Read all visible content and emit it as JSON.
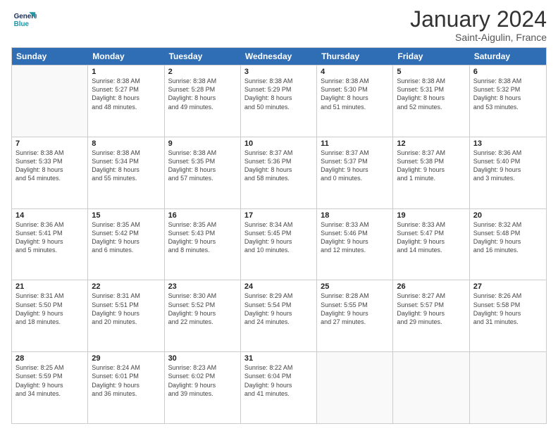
{
  "header": {
    "logo_line1": "General",
    "logo_line2": "Blue",
    "month": "January 2024",
    "location": "Saint-Aigulin, France"
  },
  "days": [
    "Sunday",
    "Monday",
    "Tuesday",
    "Wednesday",
    "Thursday",
    "Friday",
    "Saturday"
  ],
  "rows": [
    [
      {
        "day": "",
        "sunrise": "",
        "sunset": "",
        "daylight": ""
      },
      {
        "day": "1",
        "sunrise": "Sunrise: 8:38 AM",
        "sunset": "Sunset: 5:27 PM",
        "daylight": "Daylight: 8 hours and 48 minutes."
      },
      {
        "day": "2",
        "sunrise": "Sunrise: 8:38 AM",
        "sunset": "Sunset: 5:28 PM",
        "daylight": "Daylight: 8 hours and 49 minutes."
      },
      {
        "day": "3",
        "sunrise": "Sunrise: 8:38 AM",
        "sunset": "Sunset: 5:29 PM",
        "daylight": "Daylight: 8 hours and 50 minutes."
      },
      {
        "day": "4",
        "sunrise": "Sunrise: 8:38 AM",
        "sunset": "Sunset: 5:30 PM",
        "daylight": "Daylight: 8 hours and 51 minutes."
      },
      {
        "day": "5",
        "sunrise": "Sunrise: 8:38 AM",
        "sunset": "Sunset: 5:31 PM",
        "daylight": "Daylight: 8 hours and 52 minutes."
      },
      {
        "day": "6",
        "sunrise": "Sunrise: 8:38 AM",
        "sunset": "Sunset: 5:32 PM",
        "daylight": "Daylight: 8 hours and 53 minutes."
      }
    ],
    [
      {
        "day": "7",
        "sunrise": "Sunrise: 8:38 AM",
        "sunset": "Sunset: 5:33 PM",
        "daylight": "Daylight: 8 hours and 54 minutes."
      },
      {
        "day": "8",
        "sunrise": "Sunrise: 8:38 AM",
        "sunset": "Sunset: 5:34 PM",
        "daylight": "Daylight: 8 hours and 55 minutes."
      },
      {
        "day": "9",
        "sunrise": "Sunrise: 8:38 AM",
        "sunset": "Sunset: 5:35 PM",
        "daylight": "Daylight: 8 hours and 57 minutes."
      },
      {
        "day": "10",
        "sunrise": "Sunrise: 8:37 AM",
        "sunset": "Sunset: 5:36 PM",
        "daylight": "Daylight: 8 hours and 58 minutes."
      },
      {
        "day": "11",
        "sunrise": "Sunrise: 8:37 AM",
        "sunset": "Sunset: 5:37 PM",
        "daylight": "Daylight: 9 hours and 0 minutes."
      },
      {
        "day": "12",
        "sunrise": "Sunrise: 8:37 AM",
        "sunset": "Sunset: 5:38 PM",
        "daylight": "Daylight: 9 hours and 1 minute."
      },
      {
        "day": "13",
        "sunrise": "Sunrise: 8:36 AM",
        "sunset": "Sunset: 5:40 PM",
        "daylight": "Daylight: 9 hours and 3 minutes."
      }
    ],
    [
      {
        "day": "14",
        "sunrise": "Sunrise: 8:36 AM",
        "sunset": "Sunset: 5:41 PM",
        "daylight": "Daylight: 9 hours and 5 minutes."
      },
      {
        "day": "15",
        "sunrise": "Sunrise: 8:35 AM",
        "sunset": "Sunset: 5:42 PM",
        "daylight": "Daylight: 9 hours and 6 minutes."
      },
      {
        "day": "16",
        "sunrise": "Sunrise: 8:35 AM",
        "sunset": "Sunset: 5:43 PM",
        "daylight": "Daylight: 9 hours and 8 minutes."
      },
      {
        "day": "17",
        "sunrise": "Sunrise: 8:34 AM",
        "sunset": "Sunset: 5:45 PM",
        "daylight": "Daylight: 9 hours and 10 minutes."
      },
      {
        "day": "18",
        "sunrise": "Sunrise: 8:33 AM",
        "sunset": "Sunset: 5:46 PM",
        "daylight": "Daylight: 9 hours and 12 minutes."
      },
      {
        "day": "19",
        "sunrise": "Sunrise: 8:33 AM",
        "sunset": "Sunset: 5:47 PM",
        "daylight": "Daylight: 9 hours and 14 minutes."
      },
      {
        "day": "20",
        "sunrise": "Sunrise: 8:32 AM",
        "sunset": "Sunset: 5:48 PM",
        "daylight": "Daylight: 9 hours and 16 minutes."
      }
    ],
    [
      {
        "day": "21",
        "sunrise": "Sunrise: 8:31 AM",
        "sunset": "Sunset: 5:50 PM",
        "daylight": "Daylight: 9 hours and 18 minutes."
      },
      {
        "day": "22",
        "sunrise": "Sunrise: 8:31 AM",
        "sunset": "Sunset: 5:51 PM",
        "daylight": "Daylight: 9 hours and 20 minutes."
      },
      {
        "day": "23",
        "sunrise": "Sunrise: 8:30 AM",
        "sunset": "Sunset: 5:52 PM",
        "daylight": "Daylight: 9 hours and 22 minutes."
      },
      {
        "day": "24",
        "sunrise": "Sunrise: 8:29 AM",
        "sunset": "Sunset: 5:54 PM",
        "daylight": "Daylight: 9 hours and 24 minutes."
      },
      {
        "day": "25",
        "sunrise": "Sunrise: 8:28 AM",
        "sunset": "Sunset: 5:55 PM",
        "daylight": "Daylight: 9 hours and 27 minutes."
      },
      {
        "day": "26",
        "sunrise": "Sunrise: 8:27 AM",
        "sunset": "Sunset: 5:57 PM",
        "daylight": "Daylight: 9 hours and 29 minutes."
      },
      {
        "day": "27",
        "sunrise": "Sunrise: 8:26 AM",
        "sunset": "Sunset: 5:58 PM",
        "daylight": "Daylight: 9 hours and 31 minutes."
      }
    ],
    [
      {
        "day": "28",
        "sunrise": "Sunrise: 8:25 AM",
        "sunset": "Sunset: 5:59 PM",
        "daylight": "Daylight: 9 hours and 34 minutes."
      },
      {
        "day": "29",
        "sunrise": "Sunrise: 8:24 AM",
        "sunset": "Sunset: 6:01 PM",
        "daylight": "Daylight: 9 hours and 36 minutes."
      },
      {
        "day": "30",
        "sunrise": "Sunrise: 8:23 AM",
        "sunset": "Sunset: 6:02 PM",
        "daylight": "Daylight: 9 hours and 39 minutes."
      },
      {
        "day": "31",
        "sunrise": "Sunrise: 8:22 AM",
        "sunset": "Sunset: 6:04 PM",
        "daylight": "Daylight: 9 hours and 41 minutes."
      },
      {
        "day": "",
        "sunrise": "",
        "sunset": "",
        "daylight": ""
      },
      {
        "day": "",
        "sunrise": "",
        "sunset": "",
        "daylight": ""
      },
      {
        "day": "",
        "sunrise": "",
        "sunset": "",
        "daylight": ""
      }
    ]
  ]
}
